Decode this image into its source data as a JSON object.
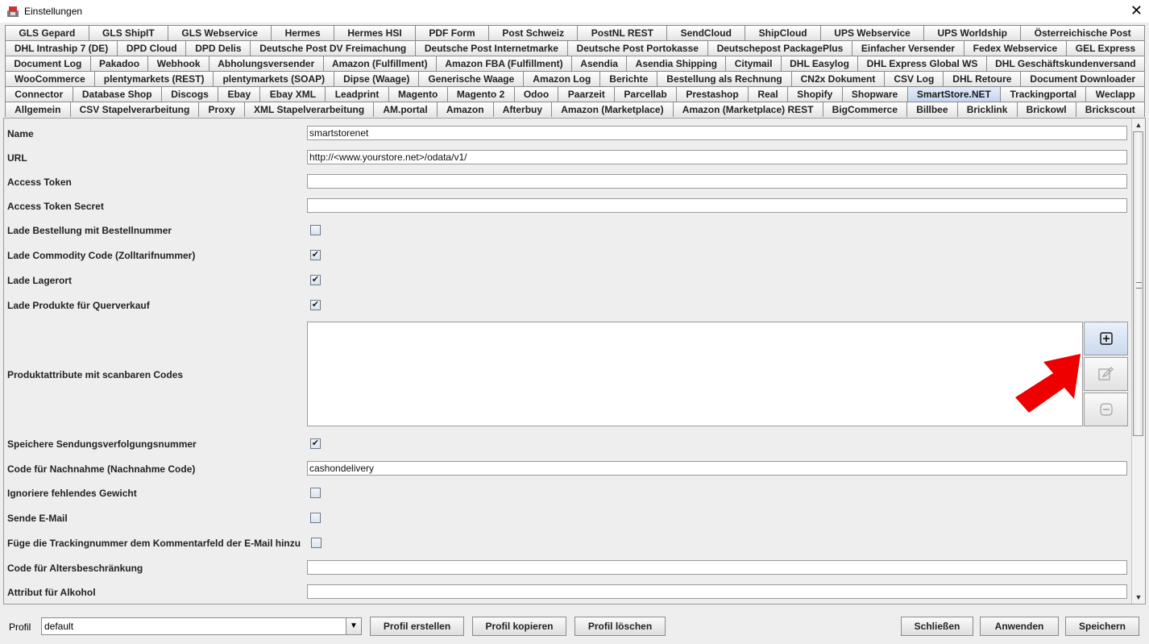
{
  "window": {
    "title": "Einstellungen",
    "close_glyph": "✕"
  },
  "tabs": {
    "row1": [
      "GLS Gepard",
      "GLS ShipIT",
      "GLS Webservice",
      "Hermes",
      "Hermes HSI",
      "PDF Form",
      "Post Schweiz",
      "PostNL REST",
      "SendCloud",
      "ShipCloud",
      "UPS Webservice",
      "UPS Worldship",
      "Österreichische Post"
    ],
    "row2": [
      "DHL Intraship 7 (DE)",
      "DPD Cloud",
      "DPD Delis",
      "Deutsche Post DV Freimachung",
      "Deutsche Post Internetmarke",
      "Deutsche Post Portokasse",
      "Deutschepost PackagePlus",
      "Einfacher Versender",
      "Fedex Webservice",
      "GEL Express"
    ],
    "row3": [
      "Document Log",
      "Pakadoo",
      "Webhook",
      "Abholungsversender",
      "Amazon (Fulfillment)",
      "Amazon FBA (Fulfillment)",
      "Asendia",
      "Asendia Shipping",
      "Citymail",
      "DHL Easylog",
      "DHL Express Global WS",
      "DHL Geschäftskundenversand"
    ],
    "row4": [
      "WooCommerce",
      "plentymarkets (REST)",
      "plentymarkets (SOAP)",
      "Dipse (Waage)",
      "Generische Waage",
      "Amazon Log",
      "Berichte",
      "Bestellung als Rechnung",
      "CN2x Dokument",
      "CSV Log",
      "DHL Retoure",
      "Document Downloader"
    ],
    "row5": [
      "Connector",
      "Database Shop",
      "Discogs",
      "Ebay",
      "Ebay XML",
      "Leadprint",
      "Magento",
      "Magento 2",
      "Odoo",
      "Paarzeit",
      "Parcellab",
      "Prestashop",
      "Real",
      "Shopify",
      "Shopware",
      "SmartStore.NET",
      "Trackingportal",
      "Weclapp"
    ],
    "row6": [
      "Allgemein",
      "CSV Stapelverarbeitung",
      "Proxy",
      "XML Stapelverarbeitung",
      "AM.portal",
      "Amazon",
      "Afterbuy",
      "Amazon (Marketplace)",
      "Amazon (Marketplace) REST",
      "BigCommerce",
      "Billbee",
      "Bricklink",
      "Brickowl",
      "Brickscout"
    ],
    "selected": "SmartStore.NET"
  },
  "form": {
    "name_label": "Name",
    "name_value": "smartstorenet",
    "url_label": "URL",
    "url_value": "http://<www.yourstore.net>/odata/v1/",
    "token_label": "Access Token",
    "token_value": "",
    "secret_label": "Access Token Secret",
    "secret_value": "",
    "lade_bestellung_label": "Lade Bestellung mit Bestellnummer",
    "lade_bestellung_checked": false,
    "commodity_label": "Lade Commodity Code (Zolltarifnummer)",
    "commodity_checked": true,
    "lagerort_label": "Lade Lagerort",
    "lagerort_checked": true,
    "querverkauf_label": "Lade Produkte für Querverkauf",
    "querverkauf_checked": true,
    "produktattribute_label": "Produktattribute mit scanbaren Codes",
    "sendungsverfolgung_label": "Speichere Sendungsverfolgungsnummer",
    "sendungsverfolgung_checked": true,
    "nachnahme_label": "Code für Nachnahme (Nachnahme Code)",
    "nachnahme_value": "cashondelivery",
    "gewicht_label": "Ignoriere fehlendes Gewicht",
    "gewicht_checked": false,
    "email_label": "Sende E-Mail",
    "email_checked": false,
    "tracking_kommentar_label": "Füge die Trackingnummer dem Kommentarfeld der E-Mail hinzu",
    "tracking_kommentar_checked": false,
    "alter_label": "Code für Altersbeschränkung",
    "alter_value": "",
    "alkohol_label": "Attribut für Alkohol",
    "alkohol_value": ""
  },
  "icons": {
    "add": "plus-square-icon",
    "edit": "edit-icon",
    "remove": "minus-circle-icon",
    "annotation": "red-arrow"
  },
  "colors": {
    "arrow": "#ee0000",
    "selected_tab": "#c3d4ef"
  },
  "bottom": {
    "profile_label": "Profil",
    "profile_value": "default",
    "create": "Profil erstellen",
    "copy": "Profil kopieren",
    "delete": "Profil löschen",
    "close": "Schließen",
    "apply": "Anwenden",
    "save": "Speichern"
  }
}
